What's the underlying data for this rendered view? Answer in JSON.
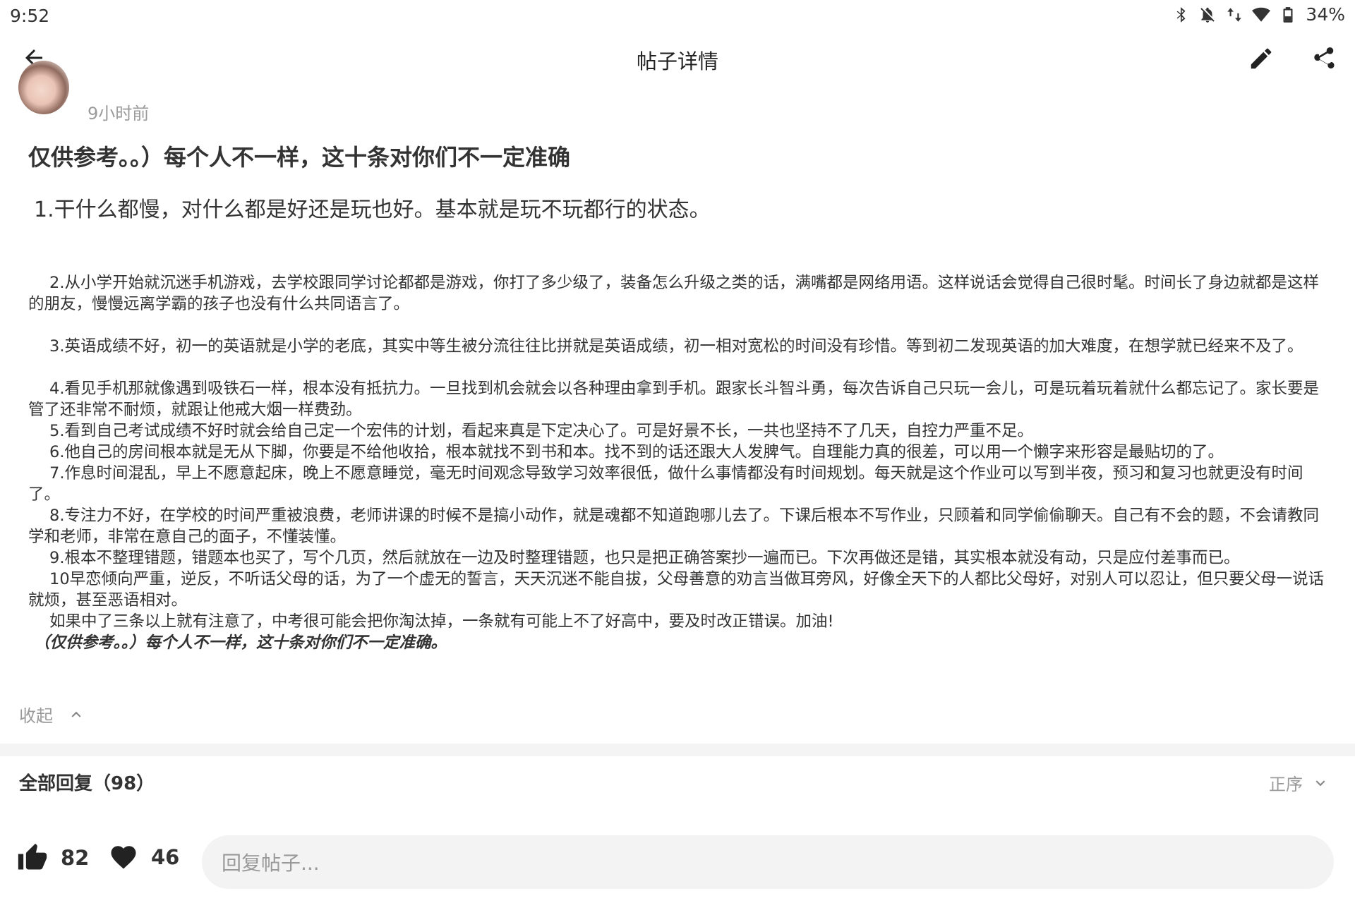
{
  "status_bar": {
    "time": "9:52",
    "battery": "34%",
    "icons": [
      "bluetooth-icon",
      "bell-off-icon",
      "data-arrows-icon",
      "wifi-icon",
      "battery-icon"
    ]
  },
  "app_bar": {
    "title": "帖子详情",
    "back_icon": "arrow-left-icon",
    "edit_icon": "pencil-icon",
    "share_icon": "share-icon"
  },
  "author": {
    "time": "9小时前"
  },
  "post": {
    "title": "仅供参考。。）每个人不一样，这十条对你们不一定准确",
    "lead": "1.干什么都慢，对什么都是好还是玩也好。基本就是玩不玩都行的状态。",
    "paragraphs": [
      "2.从小学开始就沉迷手机游戏，去学校跟同学讨论都都是游戏，你打了多少级了，装备怎么升级之类的话，满嘴都是网络用语。这样说话会觉得自己很时髦。时间长了身边就都是这样的朋友，慢慢远离学霸的孩子也没有什么共同语言了。",
      "3.英语成绩不好，初一的英语就是小学的老底，其实中等生被分流往往比拼就是英语成绩，初一相对宽松的时间没有珍惜。等到初二发现英语的加大难度，在想学就已经来不及了。",
      "4.看见手机那就像遇到吸铁石一样，根本没有抵抗力。一旦找到机会就会以各种理由拿到手机。跟家长斗智斗勇，每次告诉自己只玩一会儿，可是玩着玩着就什么都忘记了。家长要是管了还非常不耐烦，就跟让他戒大烟一样费劲。",
      "5.看到自己考试成绩不好时就会给自己定一个宏伟的计划，看起来真是下定决心了。可是好景不长，一共也坚持不了几天，自控力严重不足。",
      "6.他自己的房间根本就是无从下脚，你要是不给他收拾，根本就找不到书和本。找不到的话还跟大人发脾气。自理能力真的很差，可以用一个懒字来形容是最贴切的了。",
      "7.作息时间混乱，早上不愿意起床，晚上不愿意睡觉，毫无时间观念导致学习效率很低，做什么事情都没有时间规划。每天就是这个作业可以写到半夜，预习和复习也就更没有时间了。",
      "8.专注力不好，在学校的时间严重被浪费，老师讲课的时候不是搞小动作，就是魂都不知道跑哪儿去了。下课后根本不写作业，只顾着和同学偷偷聊天。自己有不会的题，不会请教同学和老师，非常在意自己的面子，不懂装懂。",
      "9.根本不整理错题，错题本也买了，写个几页，然后就放在一边及时整理错题，也只是把正确答案抄一遍而已。下次再做还是错，其实根本就没有动，只是应付差事而已。",
      "10早恋倾向严重，逆反，不听话父母的话，为了一个虚无的誓言，天天沉迷不能自拔，父母善意的劝言当做耳旁风，好像全天下的人都比父母好，对别人可以忍让，但只要父母一说话就烦，甚至恶语相对。",
      "如果中了三条以上就有注意了，中考很可能会把你淘汰掉，一条就有可能上不了好高中，要及时改正错误。加油!"
    ],
    "closing": "（仅供参考。。）每个人不一样，这十条对你们不一定准确。",
    "collapse_label": "收起"
  },
  "replies": {
    "header": "全部回复（98）",
    "sort_label": "正序"
  },
  "bottom_bar": {
    "like_count": "82",
    "fav_count": "46",
    "reply_placeholder": "回复帖子..."
  }
}
